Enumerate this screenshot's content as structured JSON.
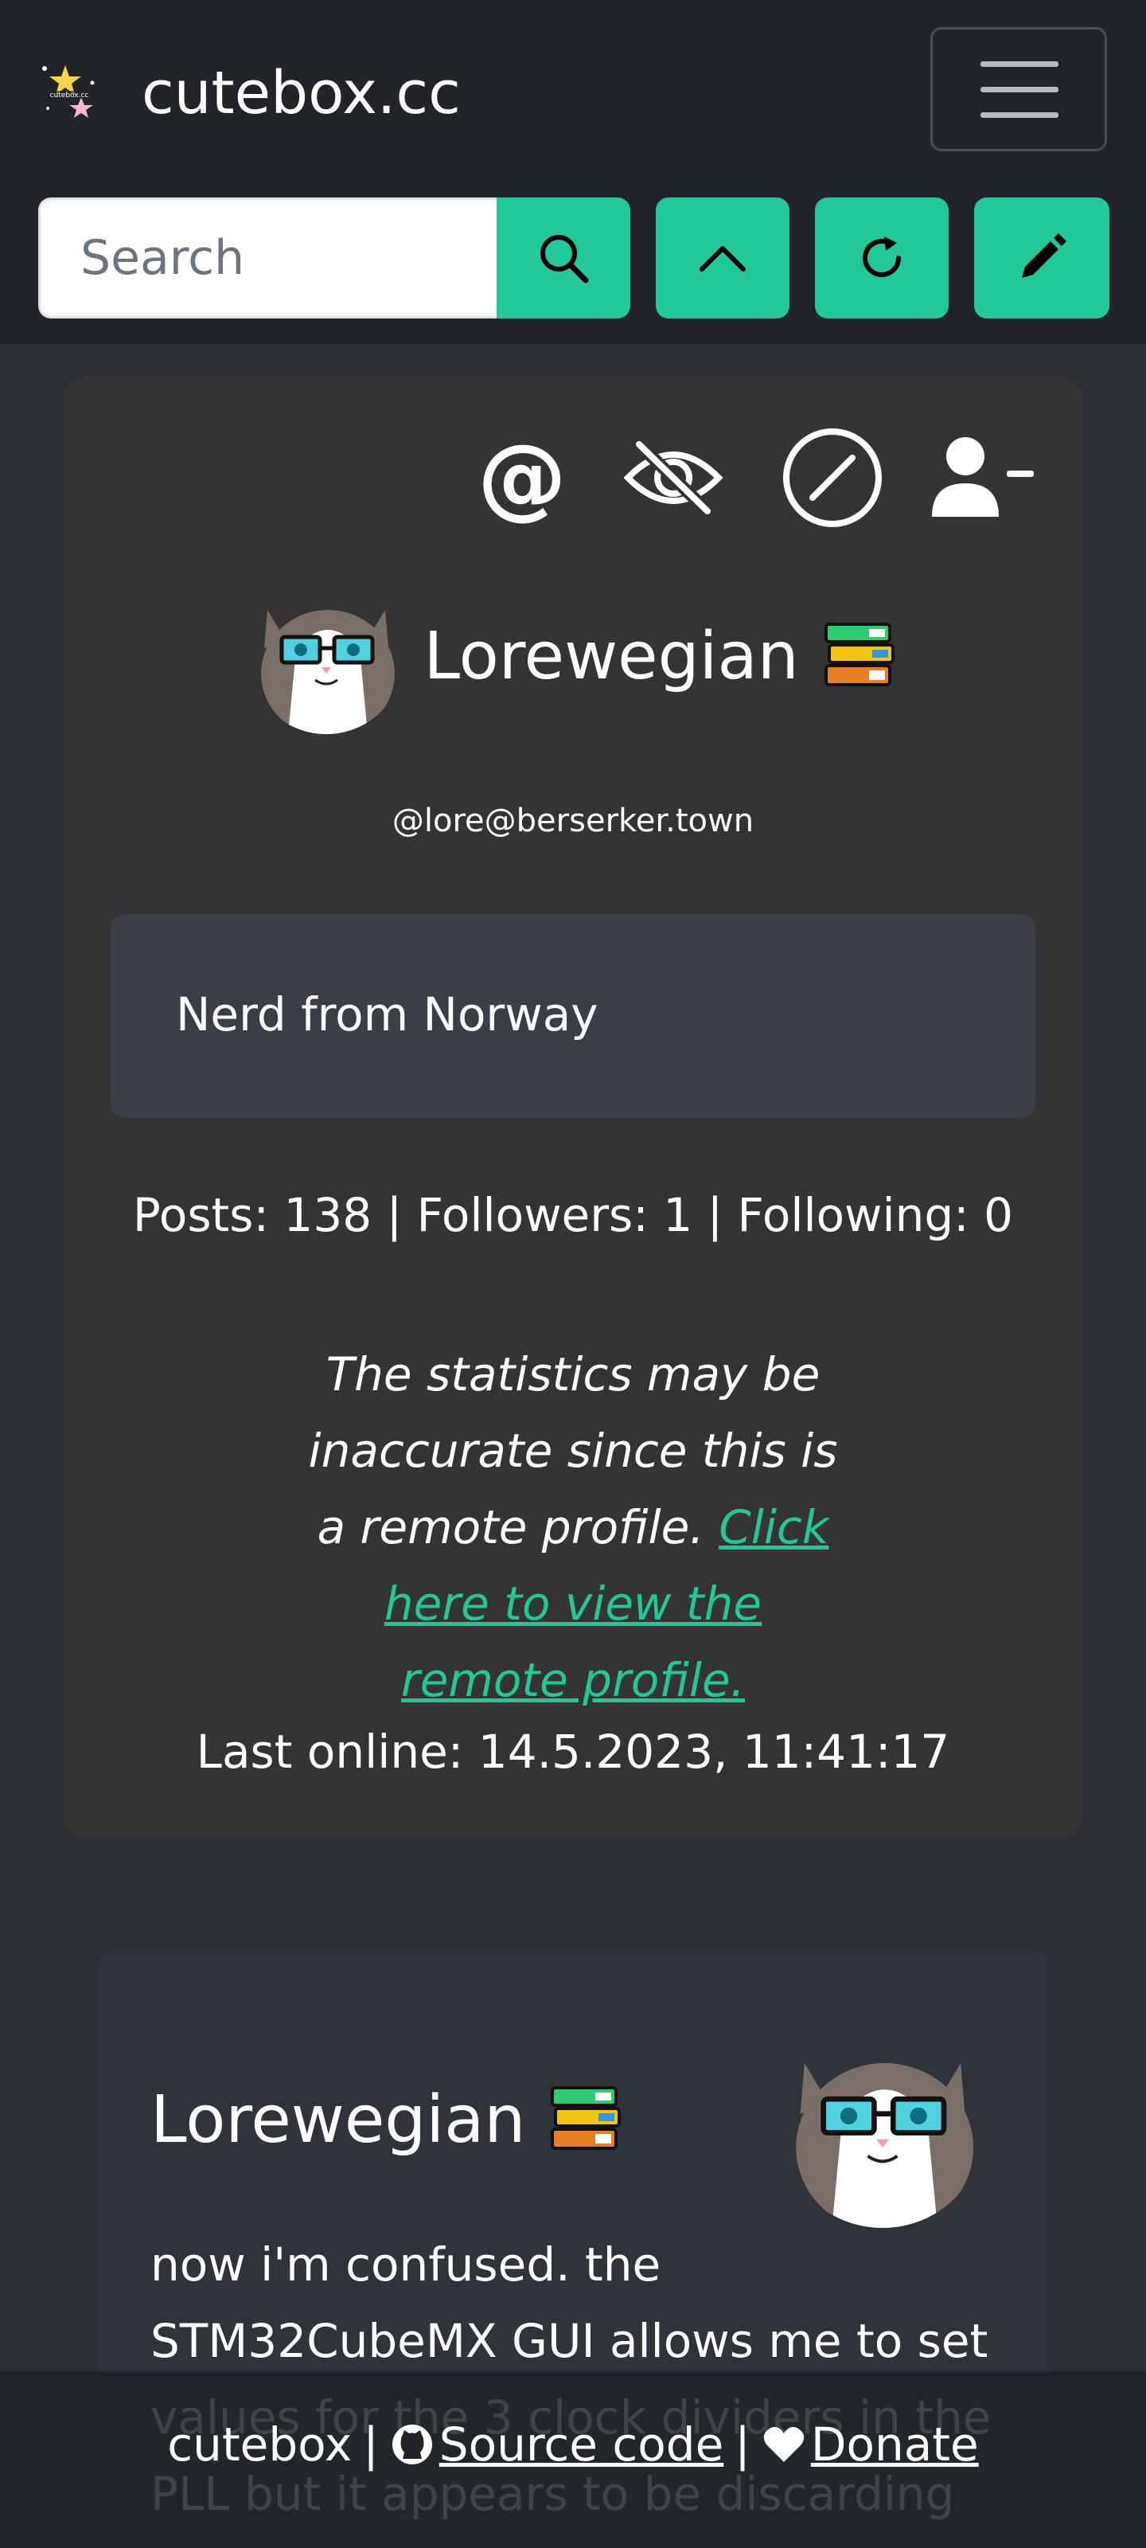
{
  "navbar": {
    "brand_name": "cutebox.cc",
    "search_placeholder": "Search"
  },
  "profile": {
    "display_name": "Lorewegian",
    "handle": "@lore@berserker.town",
    "bio": "Nerd from Norway",
    "stats": "Posts: 138 | Followers: 1 | Following: 0",
    "remote_note_text": "The statistics may be inaccurate since this is a remote profile.",
    "remote_note_link": "Click here to view the remote profile.",
    "last_online": "Last online: 14.5.2023, 11:41:17"
  },
  "post": {
    "author": "Lorewegian",
    "text": "now i'm confused. the STM32CubeMX GUI allows me to set values for the 3 clock dividers in the PLL but it appears to be discarding"
  },
  "footer": {
    "site": "cutebox",
    "source_label": "Source code",
    "donate_label": "Donate",
    "separator": "|"
  },
  "icons": {
    "search": "search-icon",
    "up": "chevron-up-icon",
    "reload": "reload-icon",
    "compose": "pencil-icon",
    "mention": "at-icon",
    "mute": "eye-slash-icon",
    "block": "block-icon",
    "unfollow": "person-dash-icon",
    "github": "github-icon",
    "heart": "heart-icon"
  },
  "colors": {
    "accent": "#20c997",
    "navbar_bg": "#212529",
    "page_bg": "#2b3035",
    "card_bg": "#343434",
    "bio_bg": "#3a3f47",
    "post_bg": "#2f343b"
  }
}
